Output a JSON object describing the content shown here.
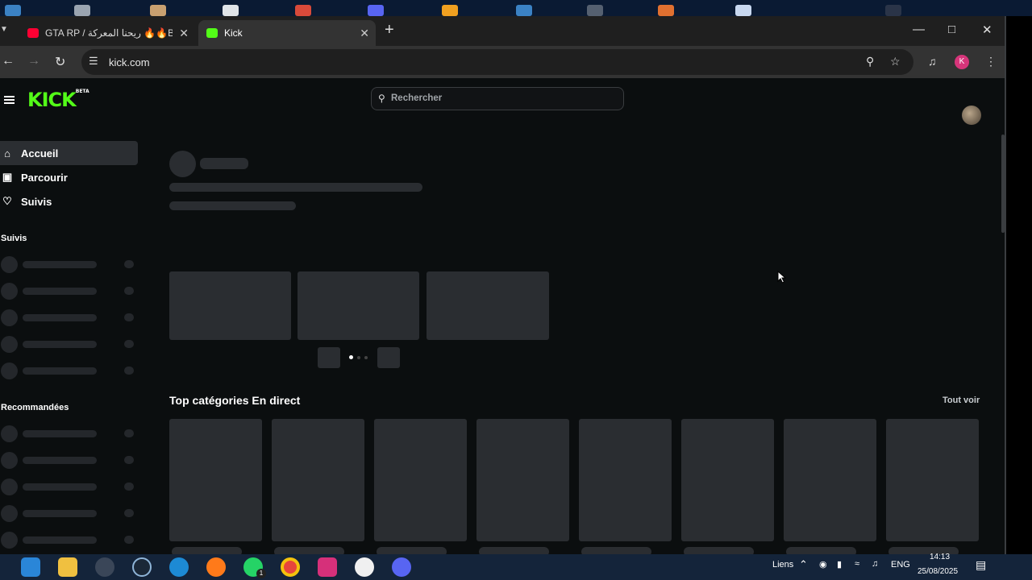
{
  "colors": {
    "kick_green": "#53fc18",
    "youtube_red": "#ff0033",
    "profile_pink": "#d6357a",
    "page_bg": "#0b0e0f",
    "skeleton": "#2a2d31"
  },
  "browser": {
    "tabs": [
      {
        "title": "GTA RP / ريحنا المعركة 🔥🔥BOB",
        "icon": "youtube-icon",
        "active": false
      },
      {
        "title": "Kick",
        "icon": "kick-icon",
        "active": true
      }
    ],
    "address": "kick.com",
    "profile_initial": "K"
  },
  "site": {
    "logo_text": "KICK",
    "logo_badge": "BETA",
    "search_placeholder": "Rechercher",
    "nav": [
      {
        "label": "Accueil",
        "icon": "home-icon",
        "active": true
      },
      {
        "label": "Parcourir",
        "icon": "browse-icon",
        "active": false
      },
      {
        "label": "Suivis",
        "icon": "heart-icon",
        "active": false
      }
    ],
    "followed_heading": "Suivis",
    "recommended_heading": "Recommandées",
    "top_categories_title": "Top catégories En direct",
    "see_all": "Tout voir"
  },
  "taskbar": {
    "apps": [
      "windows-start-icon",
      "file-explorer-icon",
      "clock-icon",
      "steam-icon",
      "edge-icon",
      "firefox-icon",
      "whatsapp-icon",
      "chrome-icon",
      "instagram-icon",
      "whatsapp-web-icon",
      "discord-icon"
    ],
    "links_label": "Liens",
    "language": "ENG",
    "time": "14:13",
    "date": "25/08/2025",
    "whatsapp_badge": "1"
  }
}
